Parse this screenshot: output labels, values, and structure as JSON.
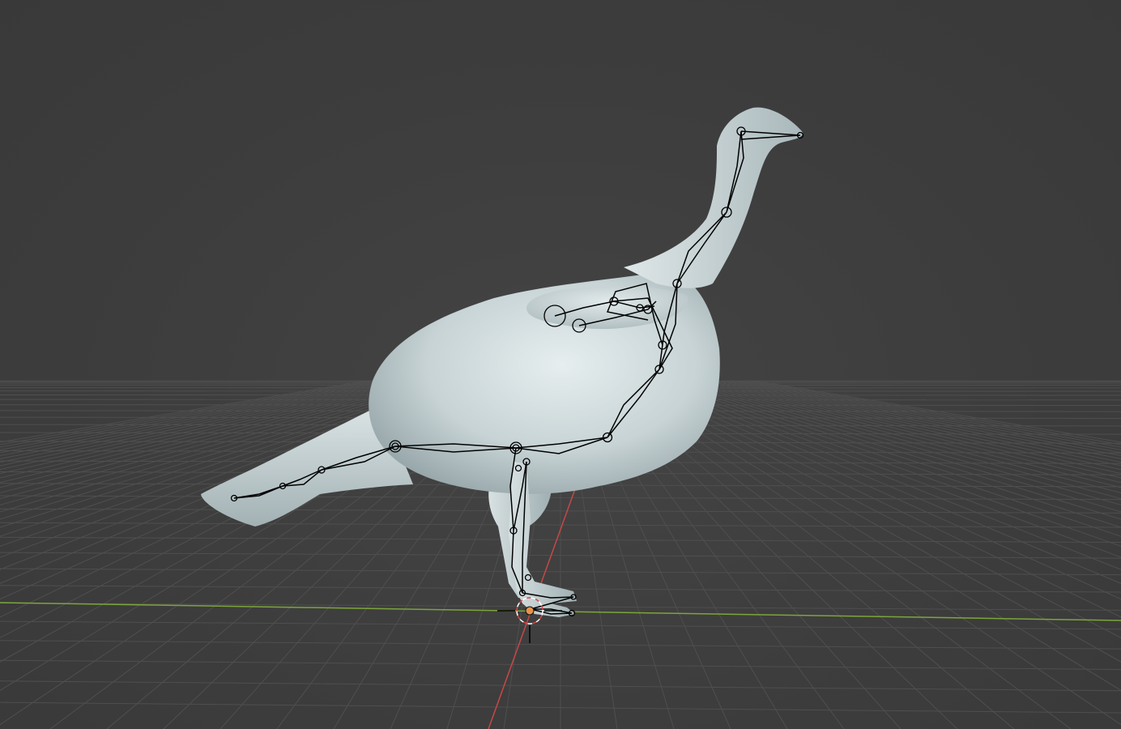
{
  "viewport": {
    "name": "3D Viewport",
    "background_color": "#3d3d3d",
    "grid_color": "#4f4f4f",
    "x_axis_color": "#d04a4a",
    "y_axis_color": "#7ca53a",
    "object": {
      "name": "turkey-mesh",
      "shading": "solid",
      "color": "#b8c6c9"
    },
    "armature": {
      "display": "octahedral",
      "bone_color": "#000000"
    },
    "cursor": {
      "name": "3d-cursor",
      "origin_color": "#e8924a"
    }
  }
}
